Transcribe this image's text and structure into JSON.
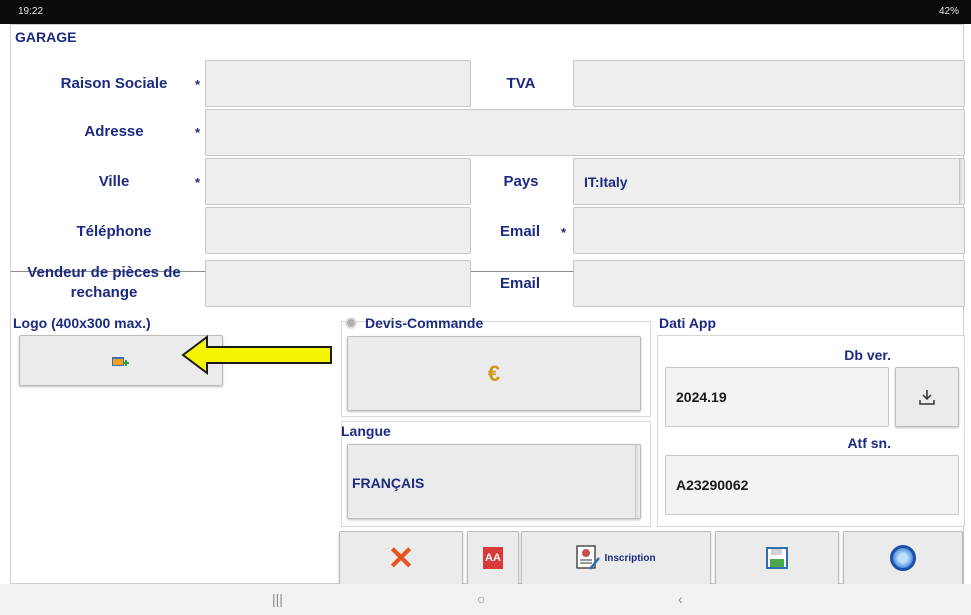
{
  "status": {
    "time": "19:22",
    "battery": "42%"
  },
  "app": {
    "title": "GARAGE"
  },
  "form": {
    "raison_sociale": {
      "label": "Raison Sociale",
      "required": "*",
      "value": ""
    },
    "tva": {
      "label": "TVA",
      "value": ""
    },
    "adresse": {
      "label": "Adresse",
      "required": "*",
      "value": ""
    },
    "ville": {
      "label": "Ville",
      "required": "*",
      "value": ""
    },
    "pays": {
      "label": "Pays",
      "value": "IT:Italy"
    },
    "telephone": {
      "label": "Téléphone",
      "value": ""
    },
    "email1": {
      "label": "Email",
      "required": "*",
      "value": ""
    },
    "vendeur": {
      "label_line1": "Vendeur de pièces de",
      "label_line2": "rechange",
      "value": ""
    },
    "email2": {
      "label": "Email",
      "value": ""
    }
  },
  "logo": {
    "label": "Logo (400x300 max.)"
  },
  "devis": {
    "label": "Devis-Commande"
  },
  "langue": {
    "label": "Langue",
    "value": "FRANÇAIS"
  },
  "dati_app": {
    "label": "Dati App",
    "db_label": "Db ver.",
    "db_value": "2024.19",
    "atf_label": "Atf sn.",
    "atf_value": "A23290062"
  },
  "toolbar": {
    "inscription_label": "Inscription"
  },
  "colors": {
    "label": "#1c2a80",
    "field": "#eeeeee",
    "cancel": "#e8531f",
    "arrow": "#f5f500"
  }
}
